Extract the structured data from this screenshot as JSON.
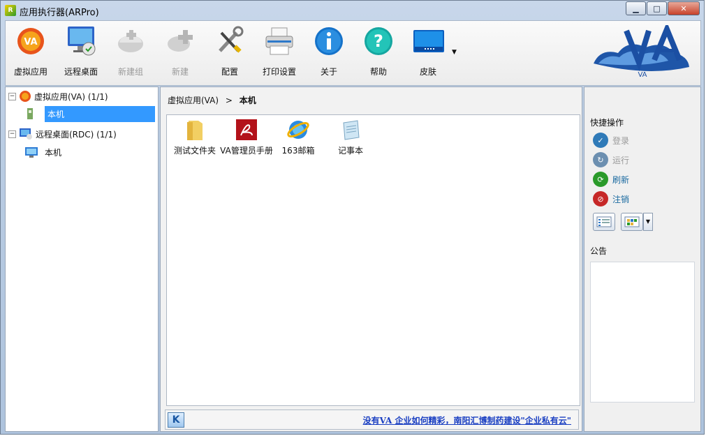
{
  "window": {
    "title": "应用执行器(ARPro)",
    "app_icon_text": "R",
    "minimize_glyph": "▁",
    "maximize_glyph": "□",
    "close_glyph": "✕"
  },
  "toolbar": {
    "buttons": [
      {
        "label": "虚拟应用",
        "icon": "va-icon",
        "enabled": true
      },
      {
        "label": "远程桌面",
        "icon": "remote-desktop-icon",
        "enabled": true
      },
      {
        "label": "新建组",
        "icon": "new-group-icon",
        "enabled": false
      },
      {
        "label": "新建",
        "icon": "new-icon",
        "enabled": false
      },
      {
        "label": "配置",
        "icon": "config-icon",
        "enabled": true
      },
      {
        "label": "打印设置",
        "icon": "printer-icon",
        "enabled": true
      },
      {
        "label": "关于",
        "icon": "info-icon",
        "enabled": true
      },
      {
        "label": "帮助",
        "icon": "help-icon",
        "enabled": true
      },
      {
        "label": "皮肤",
        "icon": "skin-icon",
        "enabled": true
      }
    ],
    "logo_text": "VA",
    "dropdown_glyph": "▼"
  },
  "tree": {
    "expand_glyph": "⊟",
    "items": [
      {
        "label": "虚拟应用(VA) (1/1)",
        "level": 0
      },
      {
        "label": "本机",
        "level": 1,
        "selected": true
      },
      {
        "label": "远程桌面(RDC) (1/1)",
        "level": 0
      },
      {
        "label": "本机",
        "level": 1,
        "selected": false
      }
    ]
  },
  "breadcrumb": {
    "parent": "虚拟应用(VA)",
    "separator": ">",
    "current": "本机"
  },
  "files": [
    {
      "label": "测试文件夹",
      "icon": "folder-icon"
    },
    {
      "label": "VA管理员手册",
      "icon": "pdf-icon"
    },
    {
      "label": "163邮箱",
      "icon": "ie-icon"
    },
    {
      "label": "记事本",
      "icon": "notepad-icon"
    }
  ],
  "bottom": {
    "k_label": "K",
    "ad_text": "没有VA 企业如何精彩，南阳汇博制药建设\"企业私有云\""
  },
  "quick_ops": {
    "title": "快捷操作",
    "actions": [
      {
        "label": "登录",
        "enabled": false,
        "color": "#2f7ab8"
      },
      {
        "label": "运行",
        "enabled": false,
        "color": "#6c8fb0"
      },
      {
        "label": "刷新",
        "enabled": true,
        "color": "#2a9a2a"
      },
      {
        "label": "注销",
        "enabled": true,
        "color": "#c62828"
      }
    ],
    "dropdown_glyph": "▼"
  },
  "notice": {
    "title": "公告"
  },
  "colors": {
    "accent": "#3399ff",
    "link": "#1a3fc2",
    "enabled_action_text": "#1a6aa0"
  }
}
